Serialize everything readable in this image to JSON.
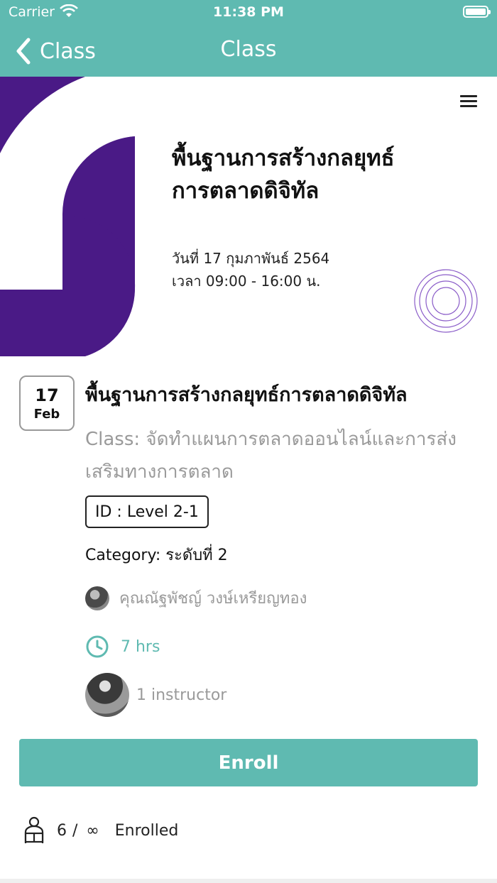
{
  "status_bar": {
    "carrier": "Carrier",
    "time": "11:38 PM"
  },
  "nav": {
    "back_label": "Class",
    "title": "Class"
  },
  "banner": {
    "title_line1": "พื้นฐานการสร้างกลยุทธ์",
    "title_line2": "การตลาดดิจิทัล",
    "date_line": "วันที่ 17 กุมภาพันธ์ 2564",
    "time_line": "เวลา 09:00 - 16:00 น.",
    "accent_color": "#4a1a86"
  },
  "course": {
    "date_day": "17",
    "date_month": "Feb",
    "title": "พื้นฐานการสร้างกลยุทธ์การตลาดดิจิทัล",
    "class_desc": "Class: จัดทำแผนการตลาดออนไลน์และการส่งเสริมทางการตลาด",
    "id_badge": "ID : Level 2-1",
    "category": "Category: ระดับที่ 2",
    "teacher_name": "คุณณัฐพัชญ์ วงษ์เหรียญทอง",
    "hours": "7 hrs",
    "instructor_count": "1 instructor"
  },
  "enroll": {
    "button_label": "Enroll",
    "count": "6",
    "slash": "/",
    "limit": "∞",
    "label": "Enrolled"
  },
  "colors": {
    "primary": "#5fbab1",
    "text_muted": "#9a9a9a"
  }
}
